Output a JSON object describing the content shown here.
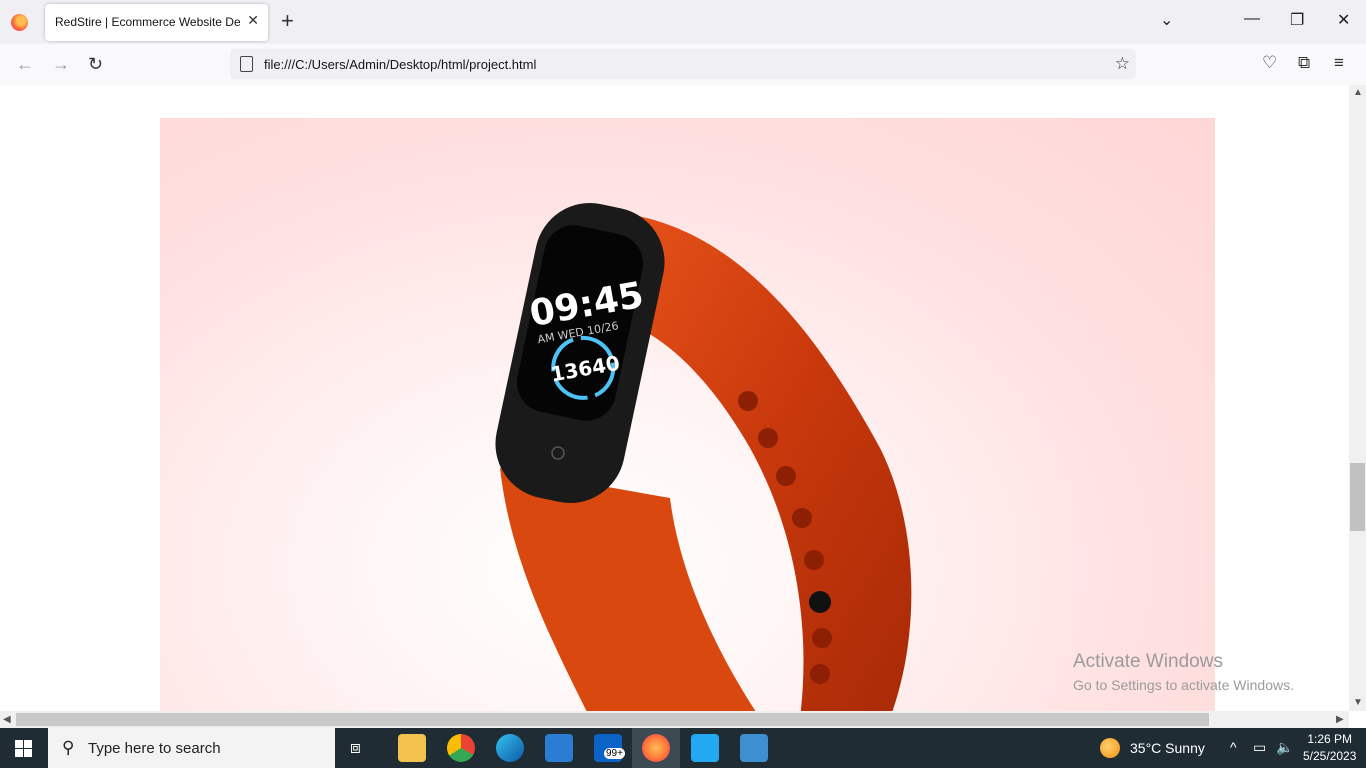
{
  "browser": {
    "tab_title": "RedStire | Ecommerce Website Design",
    "url": "file:///C:/Users/Admin/Desktop/html/project.html"
  },
  "page": {
    "hero_alt": "Orange fitness band",
    "watch_time": "09:45",
    "watch_date": "AM WED 10/26",
    "watch_steps": "13640"
  },
  "os": {
    "watermark_title": "Activate Windows",
    "watermark_sub": "Go to Settings to activate Windows.",
    "search_placeholder": "Type here to search",
    "weather": "35°C  Sunny",
    "time": "1:26 PM",
    "date": "5/25/2023",
    "mail_badge": "99+"
  }
}
